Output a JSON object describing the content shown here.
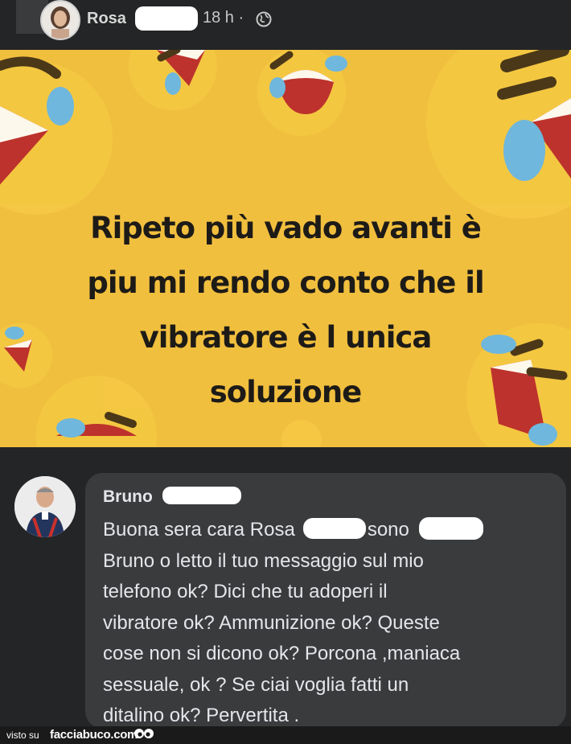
{
  "post": {
    "author_name": "Rosa",
    "time": "18 h ·",
    "privacy_icon": "globe-icon"
  },
  "image": {
    "lines": [
      "Ripeto più vado avanti è",
      "piu mi rendo conto che il",
      "vibratore è l unica",
      "soluzione"
    ],
    "background_color": "#f1bf3e",
    "decoration": "laughing-crying-emoji"
  },
  "comment": {
    "author_name": "Bruno",
    "lines": [
      "Buona sera cara Rosa",
      "Bruno o letto il tuo messaggio sul mio",
      "telefono ok? Dici che tu adoperi il",
      "vibratore ok?  Ammunizione ok? Queste",
      "cose non si dicono ok? Porcona ,maniaca",
      "sessuale, ok ? Se ciai voglia fatti un",
      "ditalino ok? Pervertita ."
    ],
    "inline_word": "sono"
  },
  "footer": {
    "visto_label": "visto su",
    "site_label": "facciabuco.com",
    "icon": "eyes-icon"
  }
}
